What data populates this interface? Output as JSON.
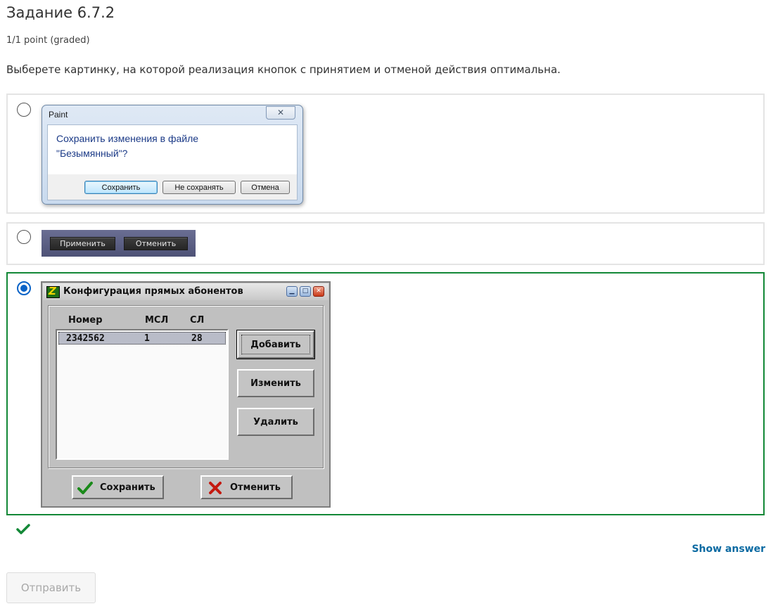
{
  "problem": {
    "title": "Задание 6.7.2",
    "points": "1/1 point (graded)",
    "question": "Выберете картинку, на которой реализация кнопок с принятием и отменой действия оптимальна."
  },
  "choice1": {
    "selected": false,
    "dialog_title": "Paint",
    "close_glyph": "✕",
    "message_line1": "Сохранить изменения в файле",
    "message_line2": "\"Безымянный\"?",
    "buttons": [
      "Сохранить",
      "Не сохранять",
      "Отмена"
    ]
  },
  "choice2": {
    "selected": false,
    "buttons": [
      "Применить",
      "Отменить"
    ]
  },
  "choice3": {
    "selected": true,
    "correct": true,
    "dialog_title": "Конфигурация прямых абонентов",
    "columns": [
      "Номер",
      "МСЛ",
      "СЛ"
    ],
    "row": [
      "2342562",
      "1",
      "28"
    ],
    "side_buttons": [
      "Добавить",
      "Изменить",
      "Удалить"
    ],
    "save_label": "Сохранить",
    "cancel_label": "Отменить"
  },
  "result": {
    "status": "correct",
    "check_color": "#138837"
  },
  "actions": {
    "show_answer": "Show answer",
    "submit": "Отправить"
  },
  "colors": {
    "correct_border": "#138837",
    "radio_selected": "#0a63c7",
    "link": "#0b6aa2"
  }
}
